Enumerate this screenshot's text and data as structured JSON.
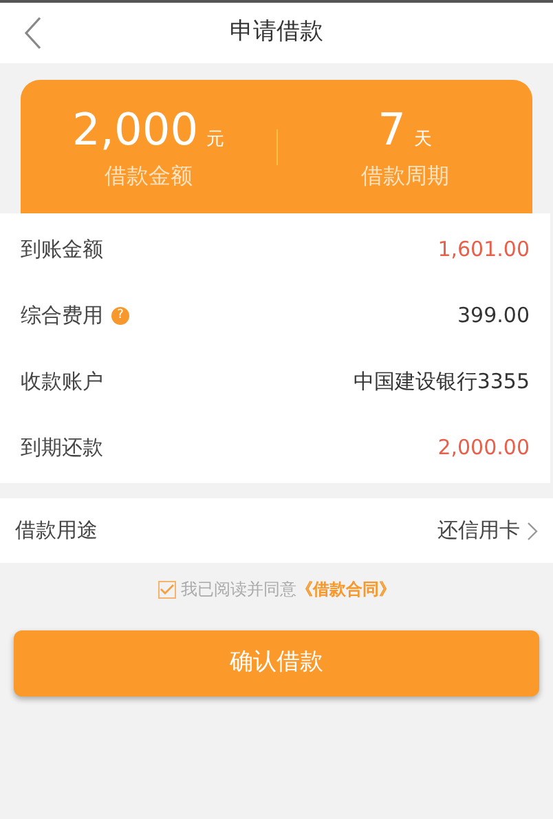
{
  "header": {
    "title": "申请借款"
  },
  "summary": [
    {
      "value": "2,000",
      "unit": "元",
      "label": "借款金额"
    },
    {
      "value": "7",
      "unit": "天",
      "label": "借款周期"
    }
  ],
  "details": [
    {
      "label": "到账金额",
      "value": "1,601.00",
      "color": "#e8604a"
    },
    {
      "label": "综合费用",
      "value": "399.00",
      "color": "#333333",
      "help": "?"
    },
    {
      "label": "收款账户",
      "value": "中国建设银行3355",
      "color": "#333333"
    },
    {
      "label": "到期还款",
      "value": "2,000.00",
      "color": "#e8604a"
    }
  ],
  "purpose": {
    "label": "借款用途",
    "value": "还信用卡"
  },
  "agreement": {
    "checked": true,
    "text": "我已阅读并同意",
    "link": "《借款合同》"
  },
  "submit": "确认借款"
}
